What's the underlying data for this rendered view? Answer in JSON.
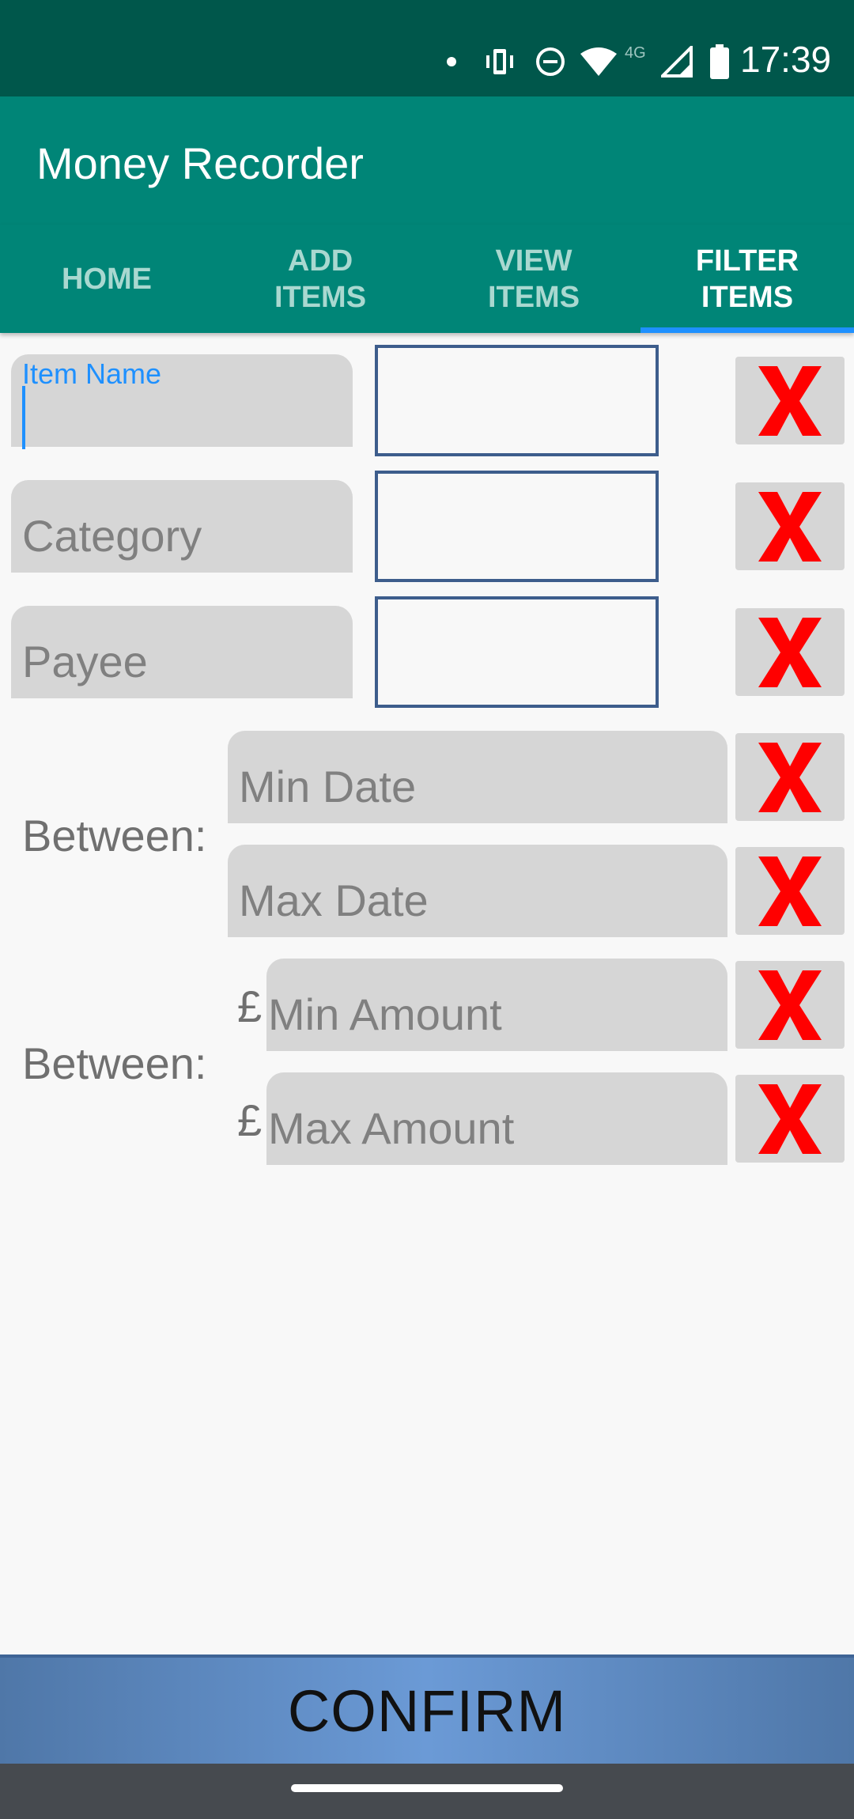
{
  "status_bar": {
    "time": "17:39",
    "network_label": "4G",
    "icons": [
      "notification-dot-icon",
      "vibrate-icon",
      "do-not-disturb-icon",
      "wifi-icon",
      "cell-signal-icon",
      "battery-icon"
    ]
  },
  "app": {
    "title": "Money Recorder"
  },
  "tabs": [
    {
      "label": "HOME",
      "active": false
    },
    {
      "label": "ADD\nITEMS",
      "active": false
    },
    {
      "label": "VIEW\nITEMS",
      "active": false
    },
    {
      "label": "FILTER\nITEMS",
      "active": true
    }
  ],
  "filters": {
    "item_name": {
      "label": "Item Name",
      "value": ""
    },
    "category": {
      "placeholder": "Category",
      "value": ""
    },
    "payee": {
      "placeholder": "Payee",
      "value": ""
    },
    "date_between_label": "Between:",
    "min_date": {
      "placeholder": "Min Date"
    },
    "max_date": {
      "placeholder": "Max Date"
    },
    "amount_between_label": "Between:",
    "currency_symbol": "£",
    "min_amount": {
      "placeholder": "Min Amount"
    },
    "max_amount": {
      "placeholder": "Max Amount"
    }
  },
  "confirm_label": "CONFIRM",
  "colors": {
    "status_bar": "#00574b",
    "app_bar": "#008577",
    "tab_indicator": "#1e90ff",
    "field_bg": "#d6d6d6",
    "box_border": "#3d5d8c",
    "clear_x": "#ff0000",
    "confirm_bg": "#6b9ad6"
  }
}
